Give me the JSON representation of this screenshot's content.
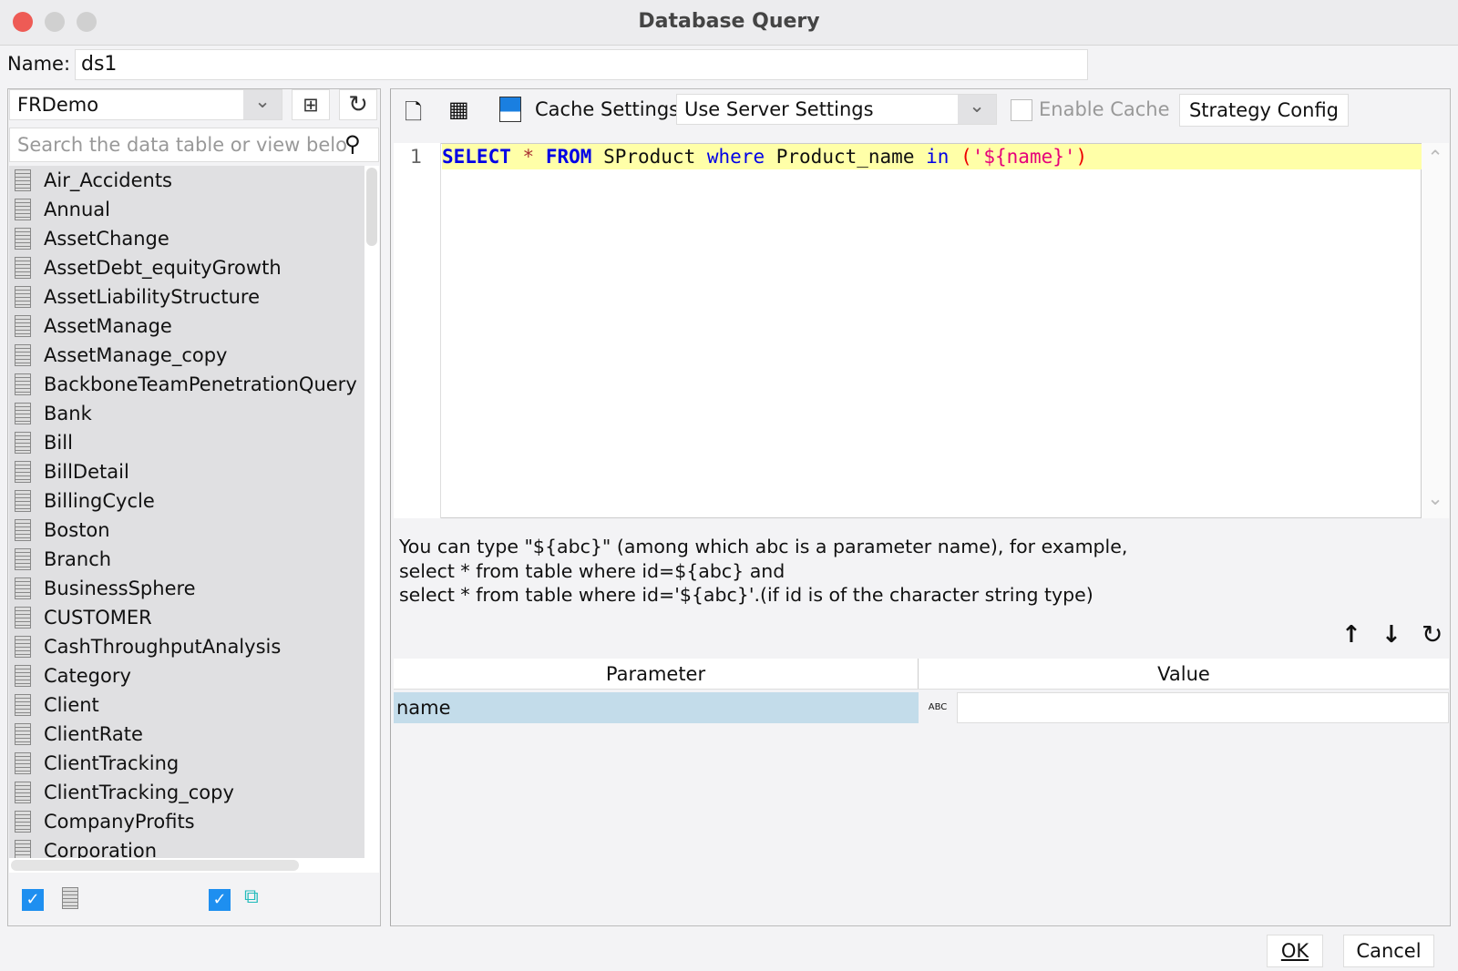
{
  "window": {
    "title": "Database Query"
  },
  "name_field": {
    "label": "Name:",
    "value": "ds1"
  },
  "left": {
    "connection": "FRDemo",
    "search_placeholder": "Search the data table or view belo",
    "tables": [
      "Air_Accidents",
      "Annual",
      "AssetChange",
      "AssetDebt_equityGrowth",
      "AssetLiabilityStructure",
      "AssetManage",
      "AssetManage_copy",
      "BackboneTeamPenetrationQuery",
      "Bank",
      "Bill",
      "BillDetail",
      "BillingCycle",
      "Boston",
      "Branch",
      "BusinessSphere",
      "CUSTOMER",
      "CashThroughputAnalysis",
      "Category",
      "Client",
      "ClientRate",
      "ClientTracking",
      "ClientTracking_copy",
      "CompanyProfits",
      "Corporation"
    ]
  },
  "toolbar": {
    "cache_label": "Cache Settings",
    "cache_option": "Use Server Settings",
    "enable_cache": "Enable Cache",
    "strategy": "Strategy Config"
  },
  "editor": {
    "line_no": "1",
    "sql": {
      "select": "SELECT",
      "star": "*",
      "from": "FROM",
      "table": "SProduct",
      "where": "where",
      "col": "Product_name",
      "in": "in",
      "open": "(",
      "str": "'${name}'",
      "close": ")"
    }
  },
  "hint": [
    "You can type \"${abc}\" (among which abc is a parameter name), for example,",
    "select * from table where id=${abc} and",
    "select * from table where id='${abc}'.(if id is of the character string type)"
  ],
  "params": {
    "headers": [
      "Parameter",
      "Value"
    ],
    "rows": [
      {
        "name": "name",
        "type": "ABC",
        "value": ""
      }
    ]
  },
  "buttons": {
    "ok": "OK",
    "cancel": "Cancel"
  },
  "colors": {
    "accent": "#1e8ff0",
    "highlight": "#ffffa8",
    "selected_row": "#c3dcea"
  }
}
